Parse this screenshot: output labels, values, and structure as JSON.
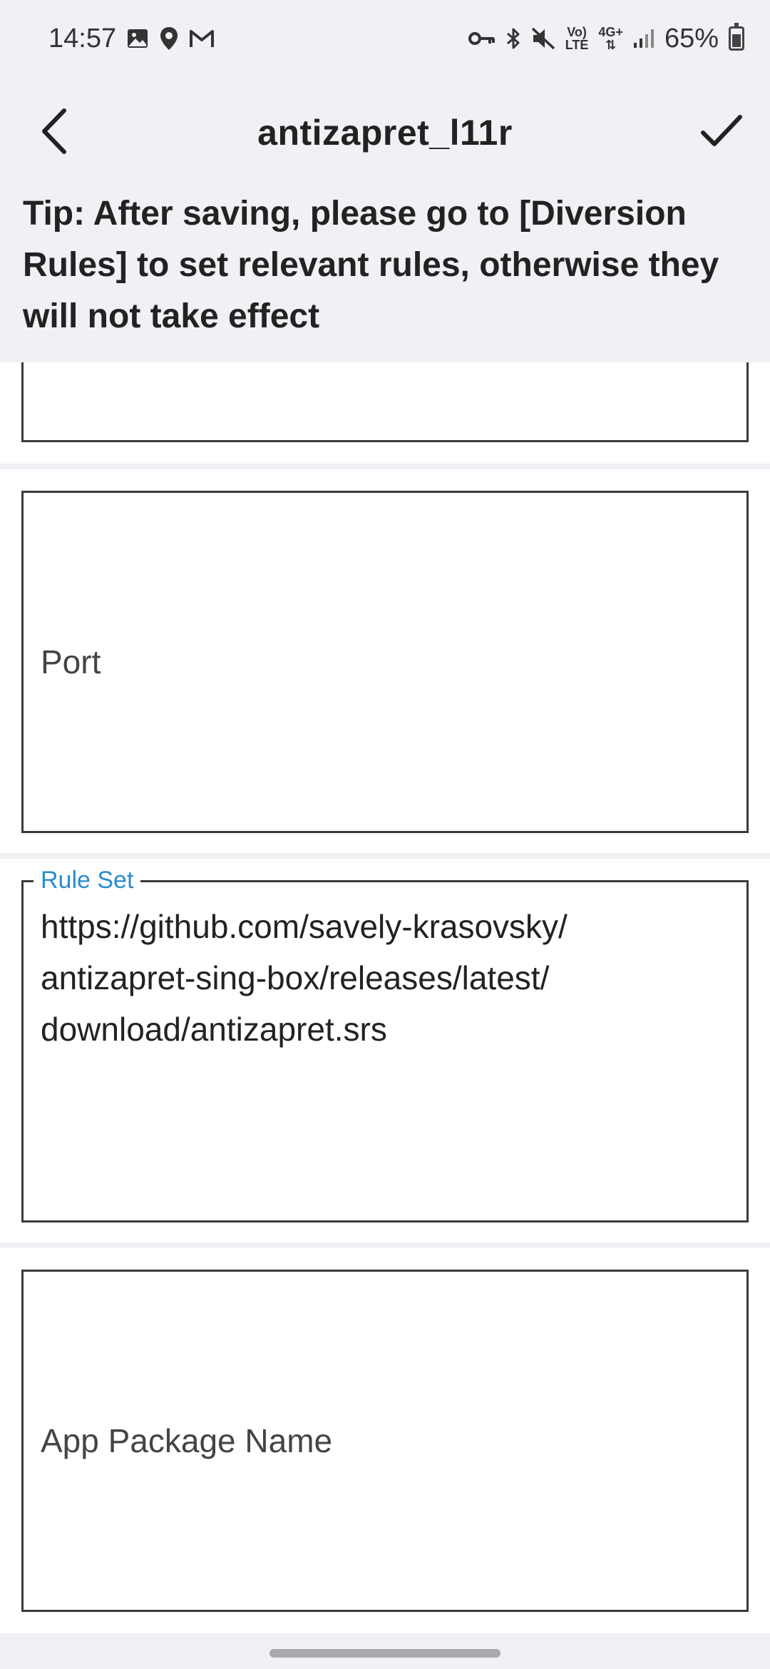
{
  "status_bar": {
    "time": "14:57",
    "left_icons": [
      "image-icon",
      "location-icon",
      "gmail-icon"
    ],
    "right_icons": [
      "vpn-key-icon",
      "bluetooth-icon",
      "mute-icon",
      "volte-icon",
      "4g-data-icon",
      "signal-icon"
    ],
    "volte_line1": "Vo)",
    "volte_line2": "LTE",
    "network_line1": "4G+",
    "network_line2": "⇅",
    "battery_percent": "65%",
    "battery_level": 0.65
  },
  "app_bar": {
    "title": "antizapret_l11r",
    "back_icon": "chevron-left-icon",
    "save_icon": "checkmark-icon"
  },
  "tip": {
    "text": "Tip: After saving, please go to [Diversion Rules] to set relevant rules, otherwise they will not take effect"
  },
  "form": {
    "port_placeholder": "Port",
    "rule_set_label": "Rule Set",
    "rule_set_value": "https://github.com/savely-krasovsky/\nantizapret-sing-box/releases/latest/\ndownload/antizapret.srs",
    "app_package_placeholder": "App Package Name"
  },
  "colors": {
    "background": "#f0f0f5",
    "field_border": "#3a3a3a",
    "label_accent": "#2a8bd1"
  }
}
